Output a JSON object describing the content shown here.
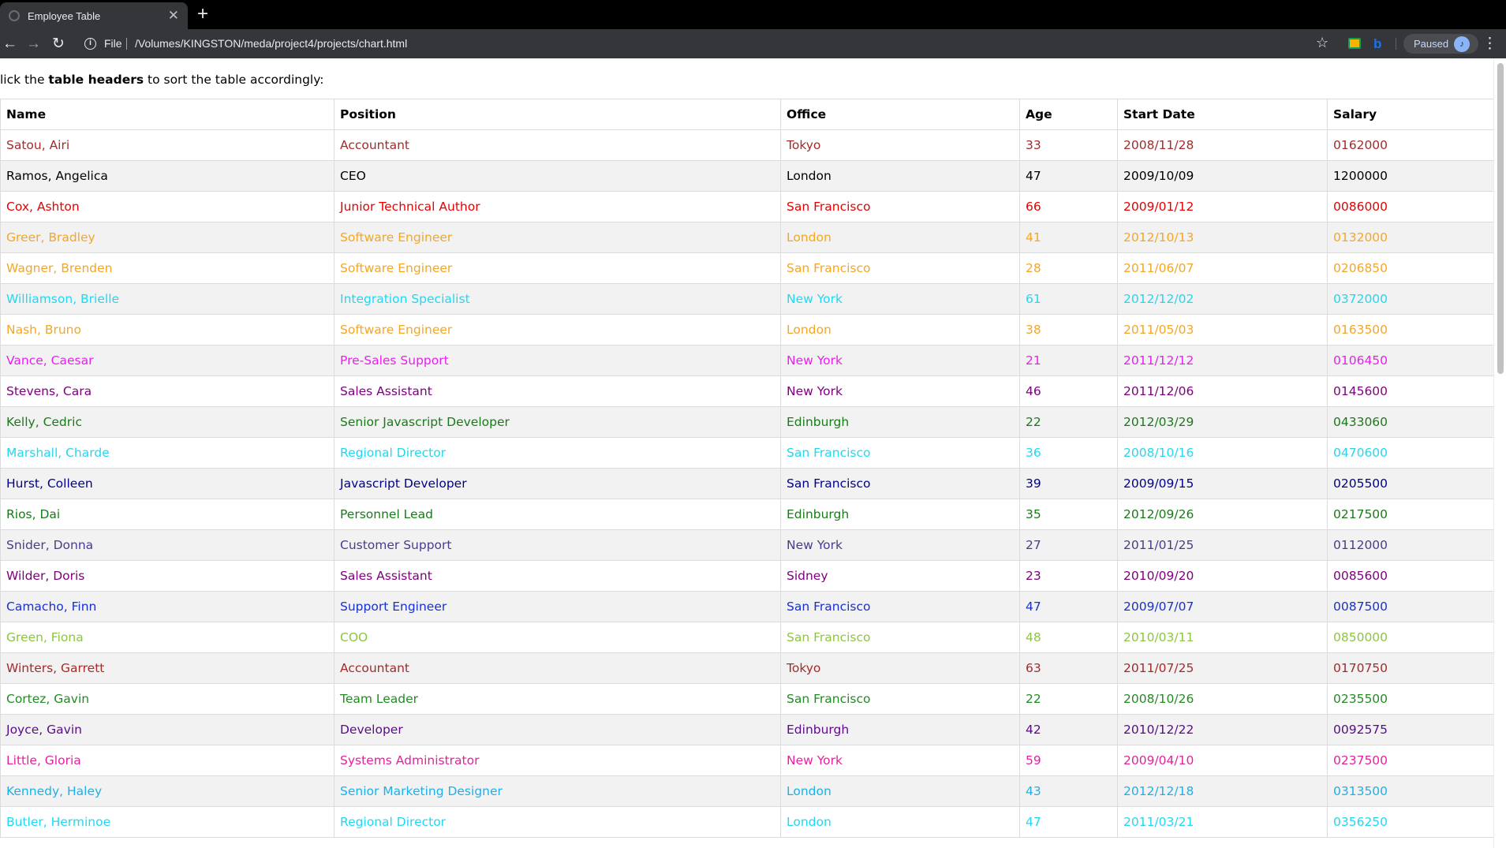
{
  "browser": {
    "tab_title": "Employee Table",
    "tab_close": "✕",
    "new_tab": "+",
    "url_scheme": "File",
    "url": "/Volumes/KINGSTON/meda/project4/projects/chart.html",
    "profile_status": "Paused",
    "icons": {
      "back": "←",
      "forward": "→",
      "reload": "↻",
      "info": "i",
      "star": "☆",
      "menu": "⋮"
    }
  },
  "page": {
    "intro_pre": "lick the ",
    "intro_bold": "table headers",
    "intro_post": " to sort the table accordingly:"
  },
  "table": {
    "headers": [
      "Name",
      "Position",
      "Office",
      "Age",
      "Start Date",
      "Salary"
    ],
    "rows": [
      {
        "name": "Satou, Airi",
        "position": "Accountant",
        "office": "Tokyo",
        "age": "33",
        "start": "2008/11/28",
        "salary": "0162000",
        "color": "#a52a2a"
      },
      {
        "name": "Ramos, Angelica",
        "position": "CEO",
        "office": "London",
        "age": "47",
        "start": "2009/10/09",
        "salary": "1200000",
        "color": "#000000"
      },
      {
        "name": "Cox, Ashton",
        "position": "Junior Technical Author",
        "office": "San Francisco",
        "age": "66",
        "start": "2009/01/12",
        "salary": "0086000",
        "color": "#e60000"
      },
      {
        "name": "Greer, Bradley",
        "position": "Software Engineer",
        "office": "London",
        "age": "41",
        "start": "2012/10/13",
        "salary": "0132000",
        "color": "#f5a623"
      },
      {
        "name": "Wagner, Brenden",
        "position": "Software Engineer",
        "office": "San Francisco",
        "age": "28",
        "start": "2011/06/07",
        "salary": "0206850",
        "color": "#f5a623"
      },
      {
        "name": "Williamson, Brielle",
        "position": "Integration Specialist",
        "office": "New York",
        "age": "61",
        "start": "2012/12/02",
        "salary": "0372000",
        "color": "#21d8f0"
      },
      {
        "name": "Nash, Bruno",
        "position": "Software Engineer",
        "office": "London",
        "age": "38",
        "start": "2011/05/03",
        "salary": "0163500",
        "color": "#f5a623"
      },
      {
        "name": "Vance, Caesar",
        "position": "Pre-Sales Support",
        "office": "New York",
        "age": "21",
        "start": "2011/12/12",
        "salary": "0106450",
        "color": "#e91ef0"
      },
      {
        "name": "Stevens, Cara",
        "position": "Sales Assistant",
        "office": "New York",
        "age": "46",
        "start": "2011/12/06",
        "salary": "0145600",
        "color": "#800080"
      },
      {
        "name": "Kelly, Cedric",
        "position": "Senior Javascript Developer",
        "office": "Edinburgh",
        "age": "22",
        "start": "2012/03/29",
        "salary": "0433060",
        "color": "#1a7a1a"
      },
      {
        "name": "Marshall, Charde",
        "position": "Regional Director",
        "office": "San Francisco",
        "age": "36",
        "start": "2008/10/16",
        "salary": "0470600",
        "color": "#21d8f0"
      },
      {
        "name": "Hurst, Colleen",
        "position": "Javascript Developer",
        "office": "San Francisco",
        "age": "39",
        "start": "2009/09/15",
        "salary": "0205500",
        "color": "#00008b"
      },
      {
        "name": "Rios, Dai",
        "position": "Personnel Lead",
        "office": "Edinburgh",
        "age": "35",
        "start": "2012/09/26",
        "salary": "0217500",
        "color": "#1a7a1a"
      },
      {
        "name": "Snider, Donna",
        "position": "Customer Support",
        "office": "New York",
        "age": "27",
        "start": "2011/01/25",
        "salary": "0112000",
        "color": "#483d8b"
      },
      {
        "name": "Wilder, Doris",
        "position": "Sales Assistant",
        "office": "Sidney",
        "age": "23",
        "start": "2010/09/20",
        "salary": "0085600",
        "color": "#800080"
      },
      {
        "name": "Camacho, Finn",
        "position": "Support Engineer",
        "office": "San Francisco",
        "age": "47",
        "start": "2009/07/07",
        "salary": "0087500",
        "color": "#1a2fd0"
      },
      {
        "name": "Green, Fiona",
        "position": "COO",
        "office": "San Francisco",
        "age": "48",
        "start": "2010/03/11",
        "salary": "0850000",
        "color": "#8cc63f"
      },
      {
        "name": "Winters, Garrett",
        "position": "Accountant",
        "office": "Tokyo",
        "age": "63",
        "start": "2011/07/25",
        "salary": "0170750",
        "color": "#a52a2a"
      },
      {
        "name": "Cortez, Gavin",
        "position": "Team Leader",
        "office": "San Francisco",
        "age": "22",
        "start": "2008/10/26",
        "salary": "0235500",
        "color": "#228b22"
      },
      {
        "name": "Joyce, Gavin",
        "position": "Developer",
        "office": "Edinburgh",
        "age": "42",
        "start": "2010/12/22",
        "salary": "0092575",
        "color": "#5a0a8a"
      },
      {
        "name": "Little, Gloria",
        "position": "Systems Administrator",
        "office": "New York",
        "age": "59",
        "start": "2009/04/10",
        "salary": "0237500",
        "color": "#e5209e"
      },
      {
        "name": "Kennedy, Haley",
        "position": "Senior Marketing Designer",
        "office": "London",
        "age": "43",
        "start": "2012/12/18",
        "salary": "0313500",
        "color": "#1eb0e8"
      },
      {
        "name": "Butler, Herminoe",
        "position": "Regional Director",
        "office": "London",
        "age": "47",
        "start": "2011/03/21",
        "salary": "0356250",
        "color": "#21d8f0"
      }
    ]
  }
}
